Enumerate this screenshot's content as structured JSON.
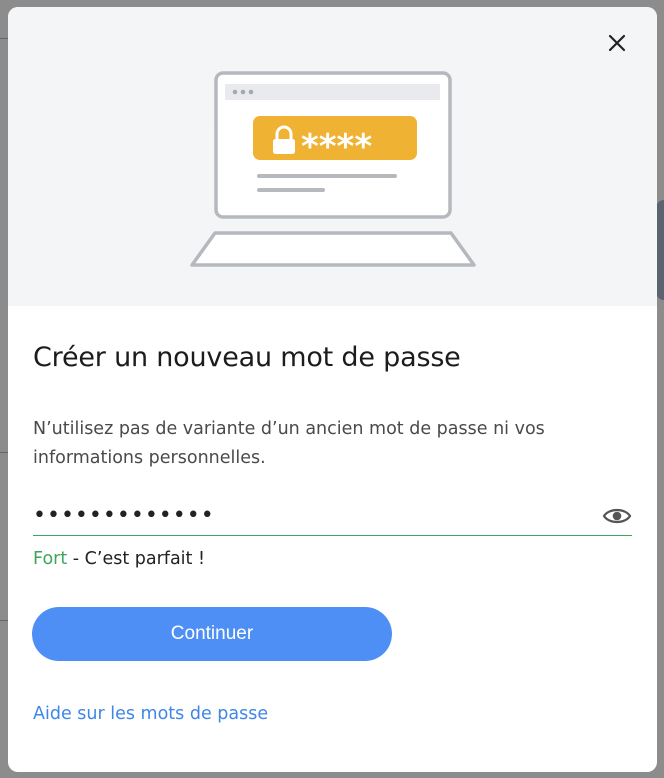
{
  "modal": {
    "title": "Créer un nouveau mot de passe",
    "description": "N’utilisez pas de variante d’un ancien mot de passe ni vos informations personnelles.",
    "close_icon": "close-icon"
  },
  "illustration": {
    "icon": "laptop-password-illustration",
    "masked_text": "****"
  },
  "password_field": {
    "value": "•••••••••••••",
    "toggle_icon": "eye-icon"
  },
  "strength": {
    "level": "Fort",
    "separator": " - ",
    "message": "C’est parfait !",
    "color": "#3ea65a"
  },
  "actions": {
    "continue_label": "Continuer",
    "help_link": "Aide sur les mots de passe"
  },
  "colors": {
    "primary": "#4e8ff5",
    "link": "#3f86e8",
    "warning_badge": "#f0b233"
  }
}
